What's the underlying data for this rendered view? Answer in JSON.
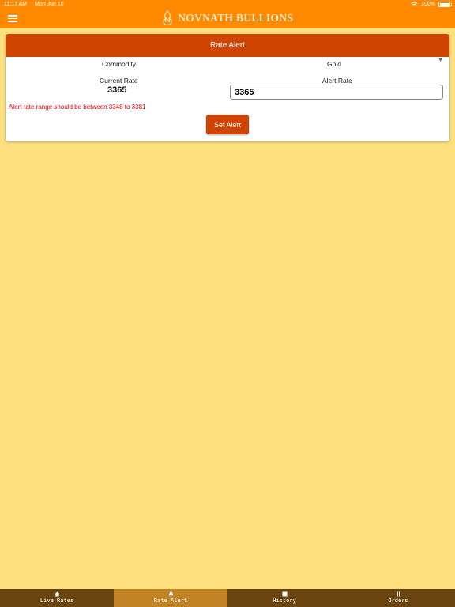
{
  "status_bar": {
    "time": "11:17 AM",
    "date": "Mon Jun 10",
    "battery": "100%"
  },
  "header": {
    "brand_name": "NOVNATH BULLIONS"
  },
  "rate_alert_card": {
    "title": "Rate Alert",
    "commodity_label": "Commodity",
    "commodity_value": "Gold",
    "current_rate_label": "Current Rate",
    "current_rate_value": "3365",
    "alert_rate_label": "Alert Rate",
    "alert_rate_input_value": "3365",
    "error_message": "Alert rate range should be between 3348 to 3381",
    "set_alert_label": "Set Alert"
  },
  "tabs": [
    {
      "label": "Live Rates",
      "icon": "home-icon",
      "active": false
    },
    {
      "label": "Rate Alert",
      "icon": "bell-icon",
      "active": true
    },
    {
      "label": "History",
      "icon": "stop-icon",
      "active": false
    },
    {
      "label": "Orders",
      "icon": "pause-icon",
      "active": false
    }
  ],
  "colors": {
    "header_orange": "#FF8A00",
    "card_header": "#CF4400",
    "background": "#FFE07E",
    "tab_bar": "#6A4510",
    "tab_active": "#C08427",
    "error": "#E00000"
  }
}
